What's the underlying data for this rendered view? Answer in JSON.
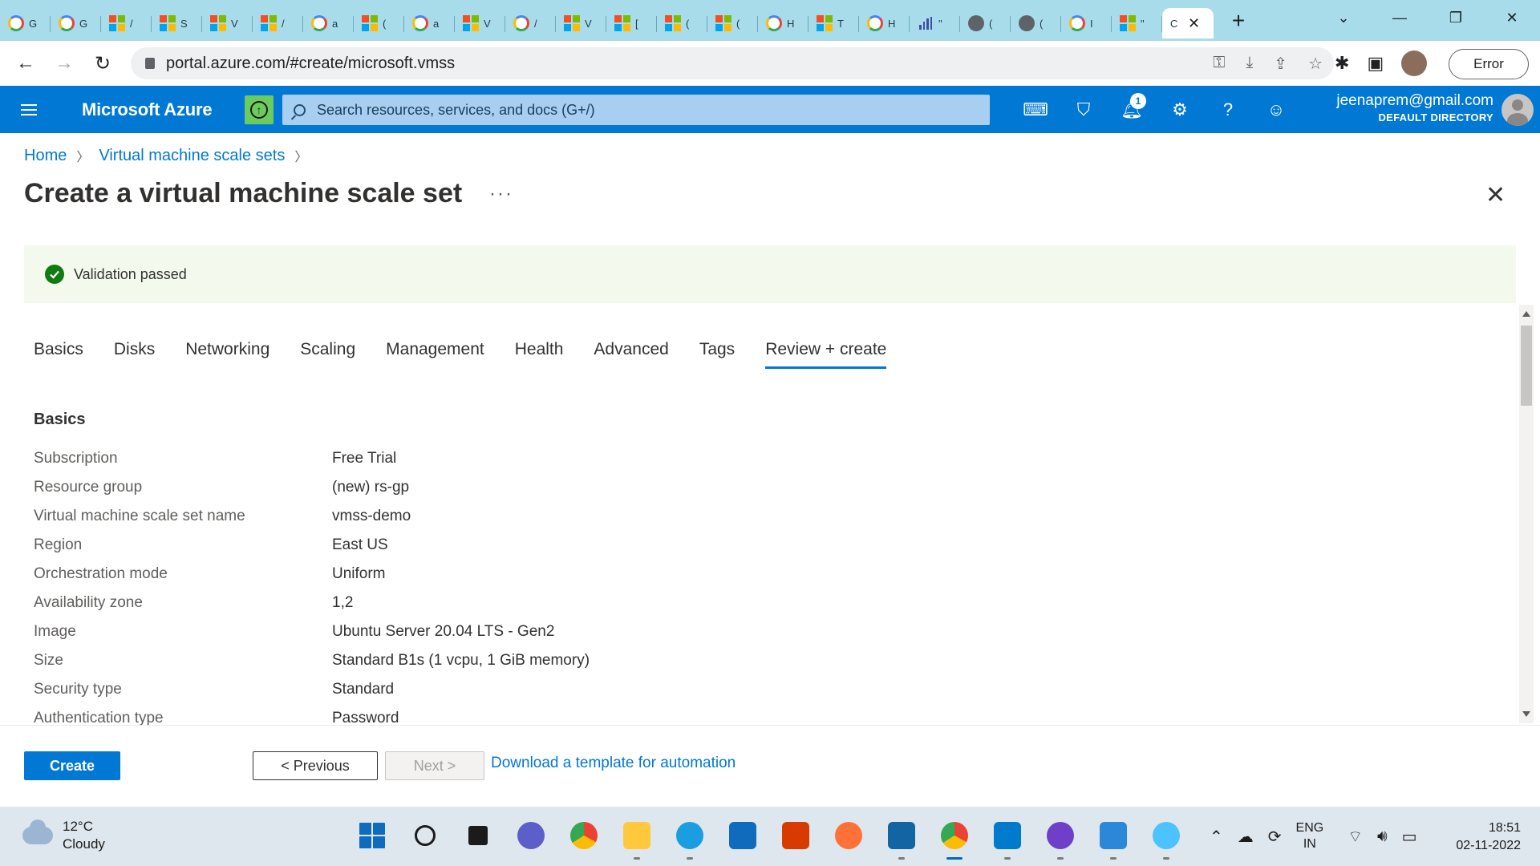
{
  "browser": {
    "tabs": [
      {
        "icon": "google-icon",
        "title": "G s"
      },
      {
        "icon": "google-icon",
        "title": "G /"
      },
      {
        "icon": "microsoft-icon",
        "title": "/"
      },
      {
        "icon": "microsoft-icon",
        "title": "S"
      },
      {
        "icon": "microsoft-icon",
        "title": "V"
      },
      {
        "icon": "microsoft-icon",
        "title": "/"
      },
      {
        "icon": "google-icon",
        "title": "a"
      },
      {
        "icon": "microsoft-icon",
        "title": "("
      },
      {
        "icon": "google-icon",
        "title": "a"
      },
      {
        "icon": "microsoft-icon",
        "title": "V"
      },
      {
        "icon": "google-icon",
        "title": "/"
      },
      {
        "icon": "microsoft-icon",
        "title": "V"
      },
      {
        "icon": "microsoft-icon",
        "title": "["
      },
      {
        "icon": "microsoft-icon",
        "title": "("
      },
      {
        "icon": "microsoft-icon",
        "title": "("
      },
      {
        "icon": "google-icon",
        "title": "H"
      },
      {
        "icon": "microsoft-icon",
        "title": "T"
      },
      {
        "icon": "google-icon",
        "title": "H"
      },
      {
        "icon": "analytics-icon",
        "title": "\""
      },
      {
        "icon": "globe-icon",
        "title": "("
      },
      {
        "icon": "globe-icon",
        "title": "("
      },
      {
        "icon": "google-icon",
        "title": "I"
      },
      {
        "icon": "microsoft-icon",
        "title": "\""
      }
    ],
    "active_tab_title": "C",
    "new_tab_label": "+",
    "url": "portal.azure.com/#create/microsoft.vmss",
    "error_button": "Error"
  },
  "azure": {
    "brand": "Microsoft Azure",
    "search_placeholder": "Search resources, services, and docs (G+/)",
    "notification_count": "1",
    "account_email": "jeenaprem@gmail.com",
    "account_directory": "DEFAULT DIRECTORY"
  },
  "breadcrumb": {
    "home": "Home",
    "parent": "Virtual machine scale sets"
  },
  "page": {
    "title": "Create a virtual machine scale set",
    "more": "···",
    "validation": "Validation passed"
  },
  "tabs": [
    {
      "label": "Basics",
      "selected": false
    },
    {
      "label": "Disks",
      "selected": false
    },
    {
      "label": "Networking",
      "selected": false
    },
    {
      "label": "Scaling",
      "selected": false
    },
    {
      "label": "Management",
      "selected": false
    },
    {
      "label": "Health",
      "selected": false
    },
    {
      "label": "Advanced",
      "selected": false
    },
    {
      "label": "Tags",
      "selected": false
    },
    {
      "label": "Review + create",
      "selected": true
    }
  ],
  "basics": {
    "heading": "Basics",
    "rows": [
      {
        "label": "Subscription",
        "value": "Free Trial"
      },
      {
        "label": "Resource group",
        "value": "(new) rs-gp"
      },
      {
        "label": "Virtual machine scale set name",
        "value": "vmss-demo"
      },
      {
        "label": "Region",
        "value": "East US"
      },
      {
        "label": "Orchestration mode",
        "value": "Uniform"
      },
      {
        "label": "Availability zone",
        "value": "1,2"
      },
      {
        "label": "Image",
        "value": "Ubuntu Server 20.04 LTS - Gen2"
      },
      {
        "label": "Size",
        "value": "Standard B1s (1 vcpu, 1 GiB memory)"
      },
      {
        "label": "Security type",
        "value": "Standard"
      },
      {
        "label": "Authentication type",
        "value": "Password"
      }
    ]
  },
  "footer": {
    "create": "Create",
    "previous": "< Previous",
    "next": "Next >",
    "download": "Download a template for automation"
  },
  "taskbar": {
    "temperature": "12°C",
    "condition": "Cloudy",
    "lang_top": "ENG",
    "lang_bottom": "IN",
    "time": "18:51",
    "date": "02-11-2022"
  }
}
